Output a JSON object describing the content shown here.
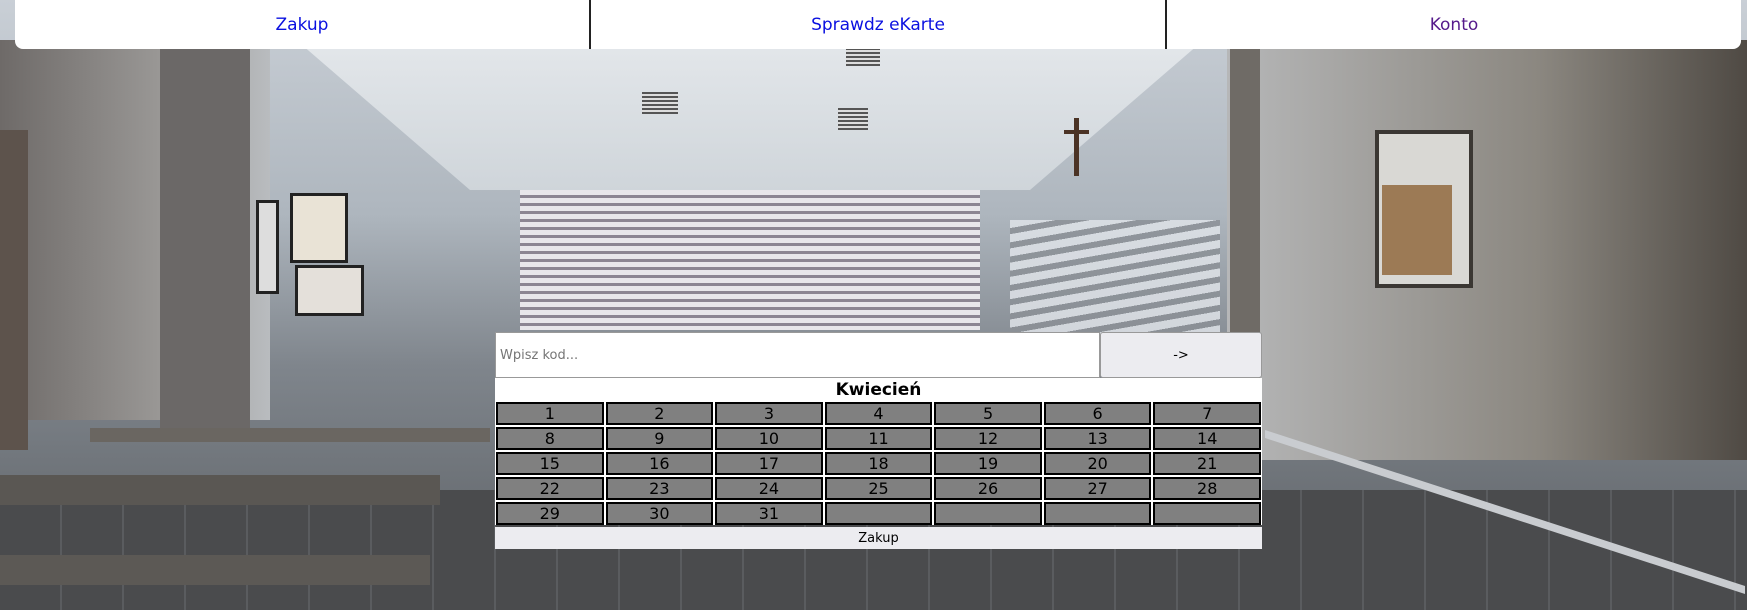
{
  "nav": {
    "items": [
      {
        "label": "Zakup"
      },
      {
        "label": "Sprawdz eKarte"
      },
      {
        "label": "Konto"
      }
    ]
  },
  "code_form": {
    "placeholder": "Wpisz kod...",
    "submit_label": "->"
  },
  "calendar": {
    "month": "Kwiecień",
    "days": [
      "1",
      "2",
      "3",
      "4",
      "5",
      "6",
      "7",
      "8",
      "9",
      "10",
      "11",
      "12",
      "13",
      "14",
      "15",
      "16",
      "17",
      "18",
      "19",
      "20",
      "21",
      "22",
      "23",
      "24",
      "25",
      "26",
      "27",
      "28",
      "29",
      "30",
      "31",
      "",
      "",
      "",
      ""
    ]
  },
  "buy_button": {
    "label": "Zakup"
  },
  "colors": {
    "link": "#0a10e0",
    "link_visited": "#551a8b",
    "day_cell": "#808080"
  }
}
